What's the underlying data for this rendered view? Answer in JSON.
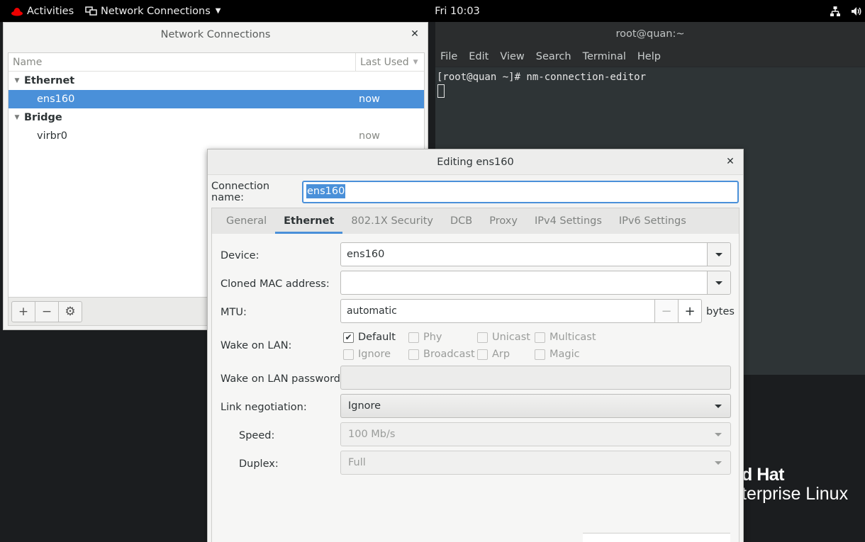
{
  "topbar": {
    "activities": "Activities",
    "app_menu": "Network Connections",
    "clock": "Fri 10:03"
  },
  "desktop": {
    "brand_line1": "d Hat",
    "brand_line2": "terprise Linux"
  },
  "terminal": {
    "title": "root@quan:~",
    "menu": [
      "File",
      "Edit",
      "View",
      "Search",
      "Terminal",
      "Help"
    ],
    "command_line": "[root@quan ~]# nm-connection-editor"
  },
  "nc_window": {
    "title": "Network Connections",
    "col_name": "Name",
    "col_last_used": "Last Used",
    "groups": [
      {
        "name": "Ethernet",
        "items": [
          {
            "name": "ens160",
            "last_used": "now",
            "selected": true
          }
        ]
      },
      {
        "name": "Bridge",
        "items": [
          {
            "name": "virbr0",
            "last_used": "now",
            "selected": false
          }
        ]
      }
    ],
    "toolbar": {
      "add": "+",
      "remove": "−"
    }
  },
  "edit_dialog": {
    "title": "Editing ens160",
    "connection_name_label": "Connection name:",
    "connection_name_value": "ens160",
    "tabs": [
      "General",
      "Ethernet",
      "802.1X Security",
      "DCB",
      "Proxy",
      "IPv4 Settings",
      "IPv6 Settings"
    ],
    "active_tab": "Ethernet",
    "ethernet": {
      "device_label": "Device:",
      "device_value": "ens160",
      "cloned_mac_label": "Cloned MAC address:",
      "cloned_mac_value": "",
      "mtu_label": "MTU:",
      "mtu_value": "automatic",
      "mtu_unit": "bytes",
      "wol_label": "Wake on LAN:",
      "wol_options": [
        {
          "label": "Default",
          "checked": true
        },
        {
          "label": "Phy",
          "checked": false
        },
        {
          "label": "Unicast",
          "checked": false
        },
        {
          "label": "Multicast",
          "checked": false
        },
        {
          "label": "Ignore",
          "checked": false
        },
        {
          "label": "Broadcast",
          "checked": false
        },
        {
          "label": "Arp",
          "checked": false
        },
        {
          "label": "Magic",
          "checked": false
        }
      ],
      "wol_password_label": "Wake on LAN password:",
      "link_neg_label": "Link negotiation:",
      "link_neg_value": "Ignore",
      "speed_label": "Speed:",
      "speed_value": "100 Mb/s",
      "duplex_label": "Duplex:",
      "duplex_value": "Full"
    }
  },
  "colors": {
    "accent": "#4a90d9",
    "topbar": "#000000",
    "terminal_bg": "#2e3436"
  }
}
